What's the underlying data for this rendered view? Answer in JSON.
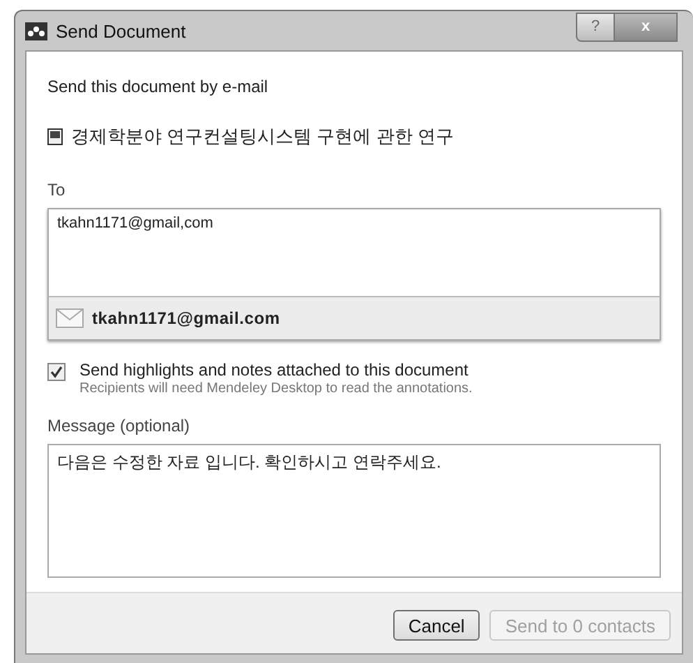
{
  "window": {
    "title": "Send Document",
    "help_button": "?",
    "close_button": "x"
  },
  "heading": "Send this document by e-mail",
  "document": {
    "title": "경제학분야 연구컨설팅시스템 구현에 관한 연구"
  },
  "to": {
    "label": "To",
    "value": "tkahn1171@gmail,com",
    "suggestions": [
      {
        "address": "tkahn1171@gmail.com"
      }
    ]
  },
  "send_highlights": {
    "label": "Send highlights and notes attached to this document",
    "checked": true,
    "hint": "Recipients will need Mendeley Desktop to read the annotations."
  },
  "message": {
    "label": "Message (optional)",
    "value": "다음은 수정한 자료 입니다. 확인하시고 연락주세요."
  },
  "buttons": [
    {
      "label": "Cancel",
      "disabled": false
    },
    {
      "label": "Send to 0 contacts",
      "disabled": true
    }
  ]
}
